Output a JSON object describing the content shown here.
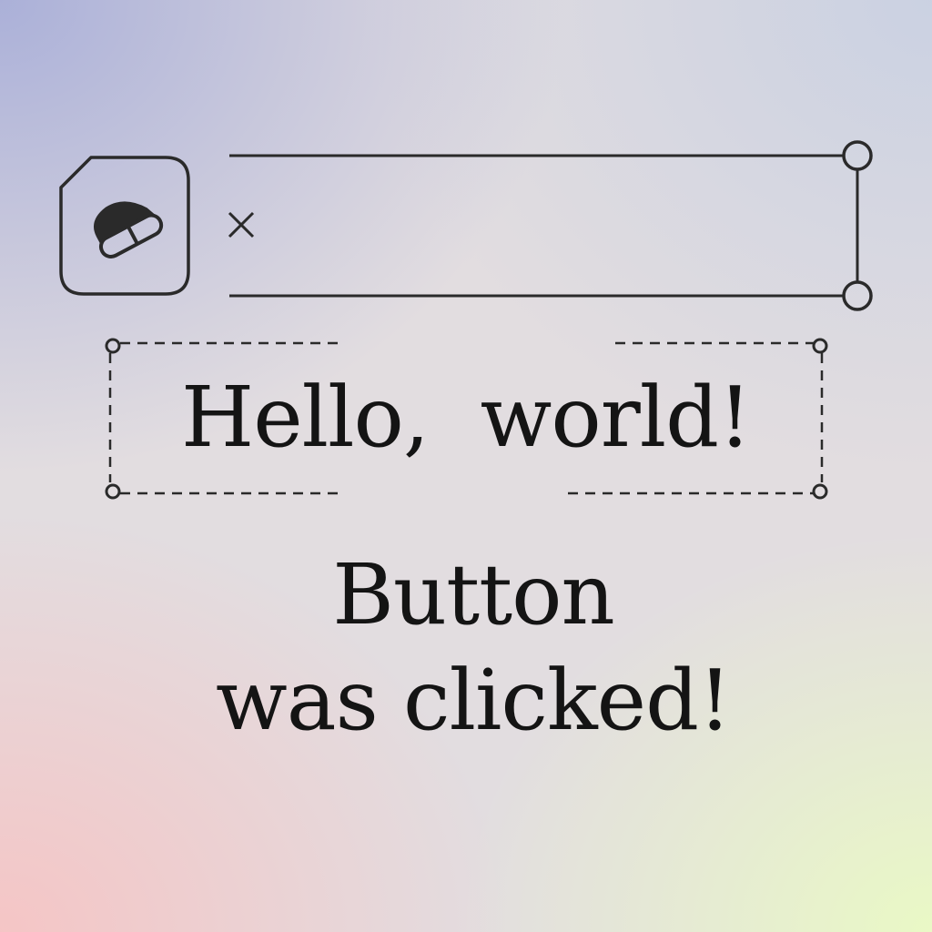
{
  "window": {
    "app_icon": "app-logo-icon",
    "close_icon": "close-icon"
  },
  "label": {
    "text": "Hello,  world!"
  },
  "status": {
    "line1": "Button",
    "line2": "was clicked!"
  },
  "colors": {
    "ink": "#141414",
    "gradient_top_left": "#a8aed8",
    "gradient_bottom_left": "#f6c4c4",
    "gradient_bottom_right": "#eafac4"
  }
}
